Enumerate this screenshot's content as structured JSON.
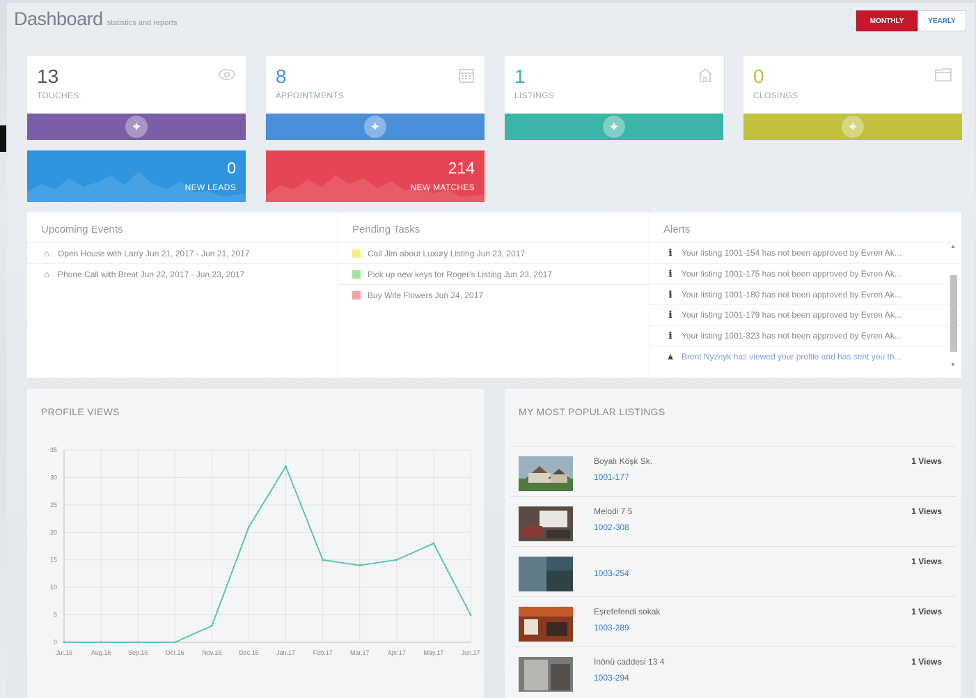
{
  "header": {
    "title": "Dashboard",
    "subtitle": "statistics and reports"
  },
  "period": {
    "monthly": "MONTHLY",
    "yearly": "YEARLY"
  },
  "stats": [
    {
      "value": "13",
      "label": "TOUCHES",
      "icon": "eye-icon",
      "color": "#7b5ea7",
      "num_color": "#555"
    },
    {
      "value": "8",
      "label": "APPOINTMENTS",
      "icon": "calendar-icon",
      "color": "#4a90d9",
      "num_color": "#4a90d9"
    },
    {
      "value": "1",
      "label": "LISTINGS",
      "icon": "home-icon",
      "color": "#3bb5a7",
      "num_color": "#3bb5a7"
    },
    {
      "value": "0",
      "label": "CLOSINGS",
      "icon": "folder-icon",
      "color": "#c2c03f",
      "num_color": "#c2c03f"
    }
  ],
  "mini_stats": [
    {
      "value": "0",
      "label": "NEW LEADS",
      "color": "#2f95e0"
    },
    {
      "value": "214",
      "label": "NEW MATCHES",
      "color": "#e64554"
    }
  ],
  "events": {
    "title": "Upcoming Events",
    "items": [
      "Open House with Larry Jun 21, 2017 - Jun 21, 2017",
      "Phone Call with Brent Jun 22, 2017 - Jun 23, 2017"
    ]
  },
  "tasks": {
    "title": "Pending Tasks",
    "items": [
      {
        "text": "Call Jim about Luxury Listing Jun 23, 2017",
        "color": "#f4f08a"
      },
      {
        "text": "Pick up new keys for Roger's Listing Jun 23, 2017",
        "color": "#9fe59a"
      },
      {
        "text": "Buy Wife Flowers Jun 24, 2017",
        "color": "#f2a3a8"
      }
    ]
  },
  "alerts": {
    "title": "Alerts",
    "items": [
      {
        "text": "Your listing 1001-154 has not been approved by Evren Ak...",
        "icon": "info-icon"
      },
      {
        "text": "Your listing 1001-175 has not been approved by Evren Ak...",
        "icon": "info-icon"
      },
      {
        "text": "Your listing 1001-180 has not been approved by Evren Ak...",
        "icon": "info-icon"
      },
      {
        "text": "Your listing 1001-179 has not been approved by Evren Ak...",
        "icon": "info-icon"
      },
      {
        "text": "Your listing 1001-323 has not been approved by Evren Ak...",
        "icon": "info-icon"
      },
      {
        "text": "Brent Nyznyk has viewed your profile and has sent you th...",
        "icon": "warning-icon"
      }
    ]
  },
  "profile_views": {
    "title": "PROFILE VIEWS"
  },
  "chart_data": {
    "type": "line",
    "title": "PROFILE VIEWS",
    "categories": [
      "Jul.16",
      "Aug.16",
      "Sep.16",
      "Oct.16",
      "Nov.16",
      "Dec.16",
      "Jan.17",
      "Feb.17",
      "Mar.17",
      "Apr.17",
      "May.17",
      "Jun.17"
    ],
    "series": [
      {
        "values": [
          0,
          0,
          0,
          0,
          3,
          21,
          32,
          15,
          14,
          15,
          18,
          5
        ]
      }
    ],
    "ylim": [
      0,
      35
    ],
    "yticks": [
      0,
      5,
      10,
      15,
      20,
      25,
      30,
      35
    ],
    "grid": true,
    "line_color": "#5fc2b8"
  },
  "listings": {
    "title": "MY MOST POPULAR LISTINGS",
    "items": [
      {
        "name": "Boyalı Köşk Sk.",
        "code": "1001-177",
        "views": "1 Views"
      },
      {
        "name": "Melodi 7 5",
        "code": "1002-308",
        "views": "1 Views"
      },
      {
        "name": "",
        "code": "1003-254",
        "views": "1 Views"
      },
      {
        "name": "Eşrefefendi sokak",
        "code": "1003-289",
        "views": "1 Views"
      },
      {
        "name": "İnönü caddesi 13 4",
        "code": "1003-294",
        "views": "1 Views"
      }
    ]
  }
}
